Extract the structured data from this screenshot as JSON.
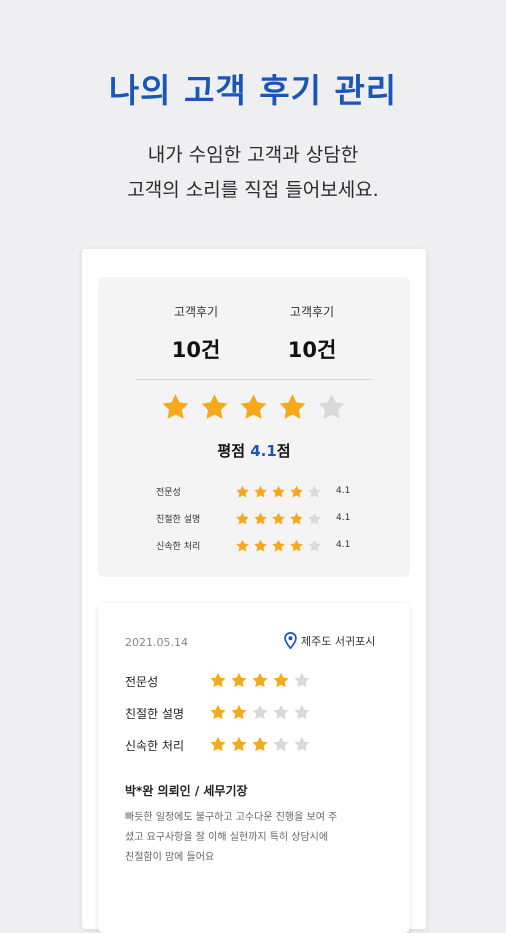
{
  "header": {
    "title": "나의 고객 후기 관리",
    "subtitle_line1": "내가 수임한 고객과 상담한",
    "subtitle_line2": "고객의 소리를 직접 들어보세요."
  },
  "summary": {
    "stats": [
      {
        "label": "고객후기",
        "value": "10건"
      },
      {
        "label": "고객후기",
        "value": "10건"
      }
    ],
    "stars_filled": 4,
    "stars_total": 5,
    "rating_prefix": "평점 ",
    "rating_value": "4.1",
    "rating_suffix": "점",
    "categories": [
      {
        "label": "전문성",
        "filled": 4,
        "score": "4.1"
      },
      {
        "label": "친절한 설명",
        "filled": 4,
        "score": "4.1"
      },
      {
        "label": "신속한 처리",
        "filled": 4,
        "score": "4.1"
      }
    ]
  },
  "review": {
    "date": "2021.05.14",
    "location": "제주도 서귀포시",
    "location_icon": "map-pin-icon",
    "categories": [
      {
        "label": "전문성",
        "filled": 4
      },
      {
        "label": "친절한 설명",
        "filled": 2
      },
      {
        "label": "신속한 처리",
        "filled": 3
      }
    ],
    "author": "박*완 의뢰인 / 세무기장",
    "body_line1": "빠듯한 일정에도 불구하고 고수다운 진행을 보여 주",
    "body_line2": "셨고 요구사항을 잘 이해 실현까지 특히 상담시에",
    "body_line3": "친절함이 맘에 들어요"
  },
  "colors": {
    "accent": "#1a56b8",
    "star_filled": "#f6a91a",
    "star_empty": "#d9d9dc",
    "background": "#efeff1"
  }
}
